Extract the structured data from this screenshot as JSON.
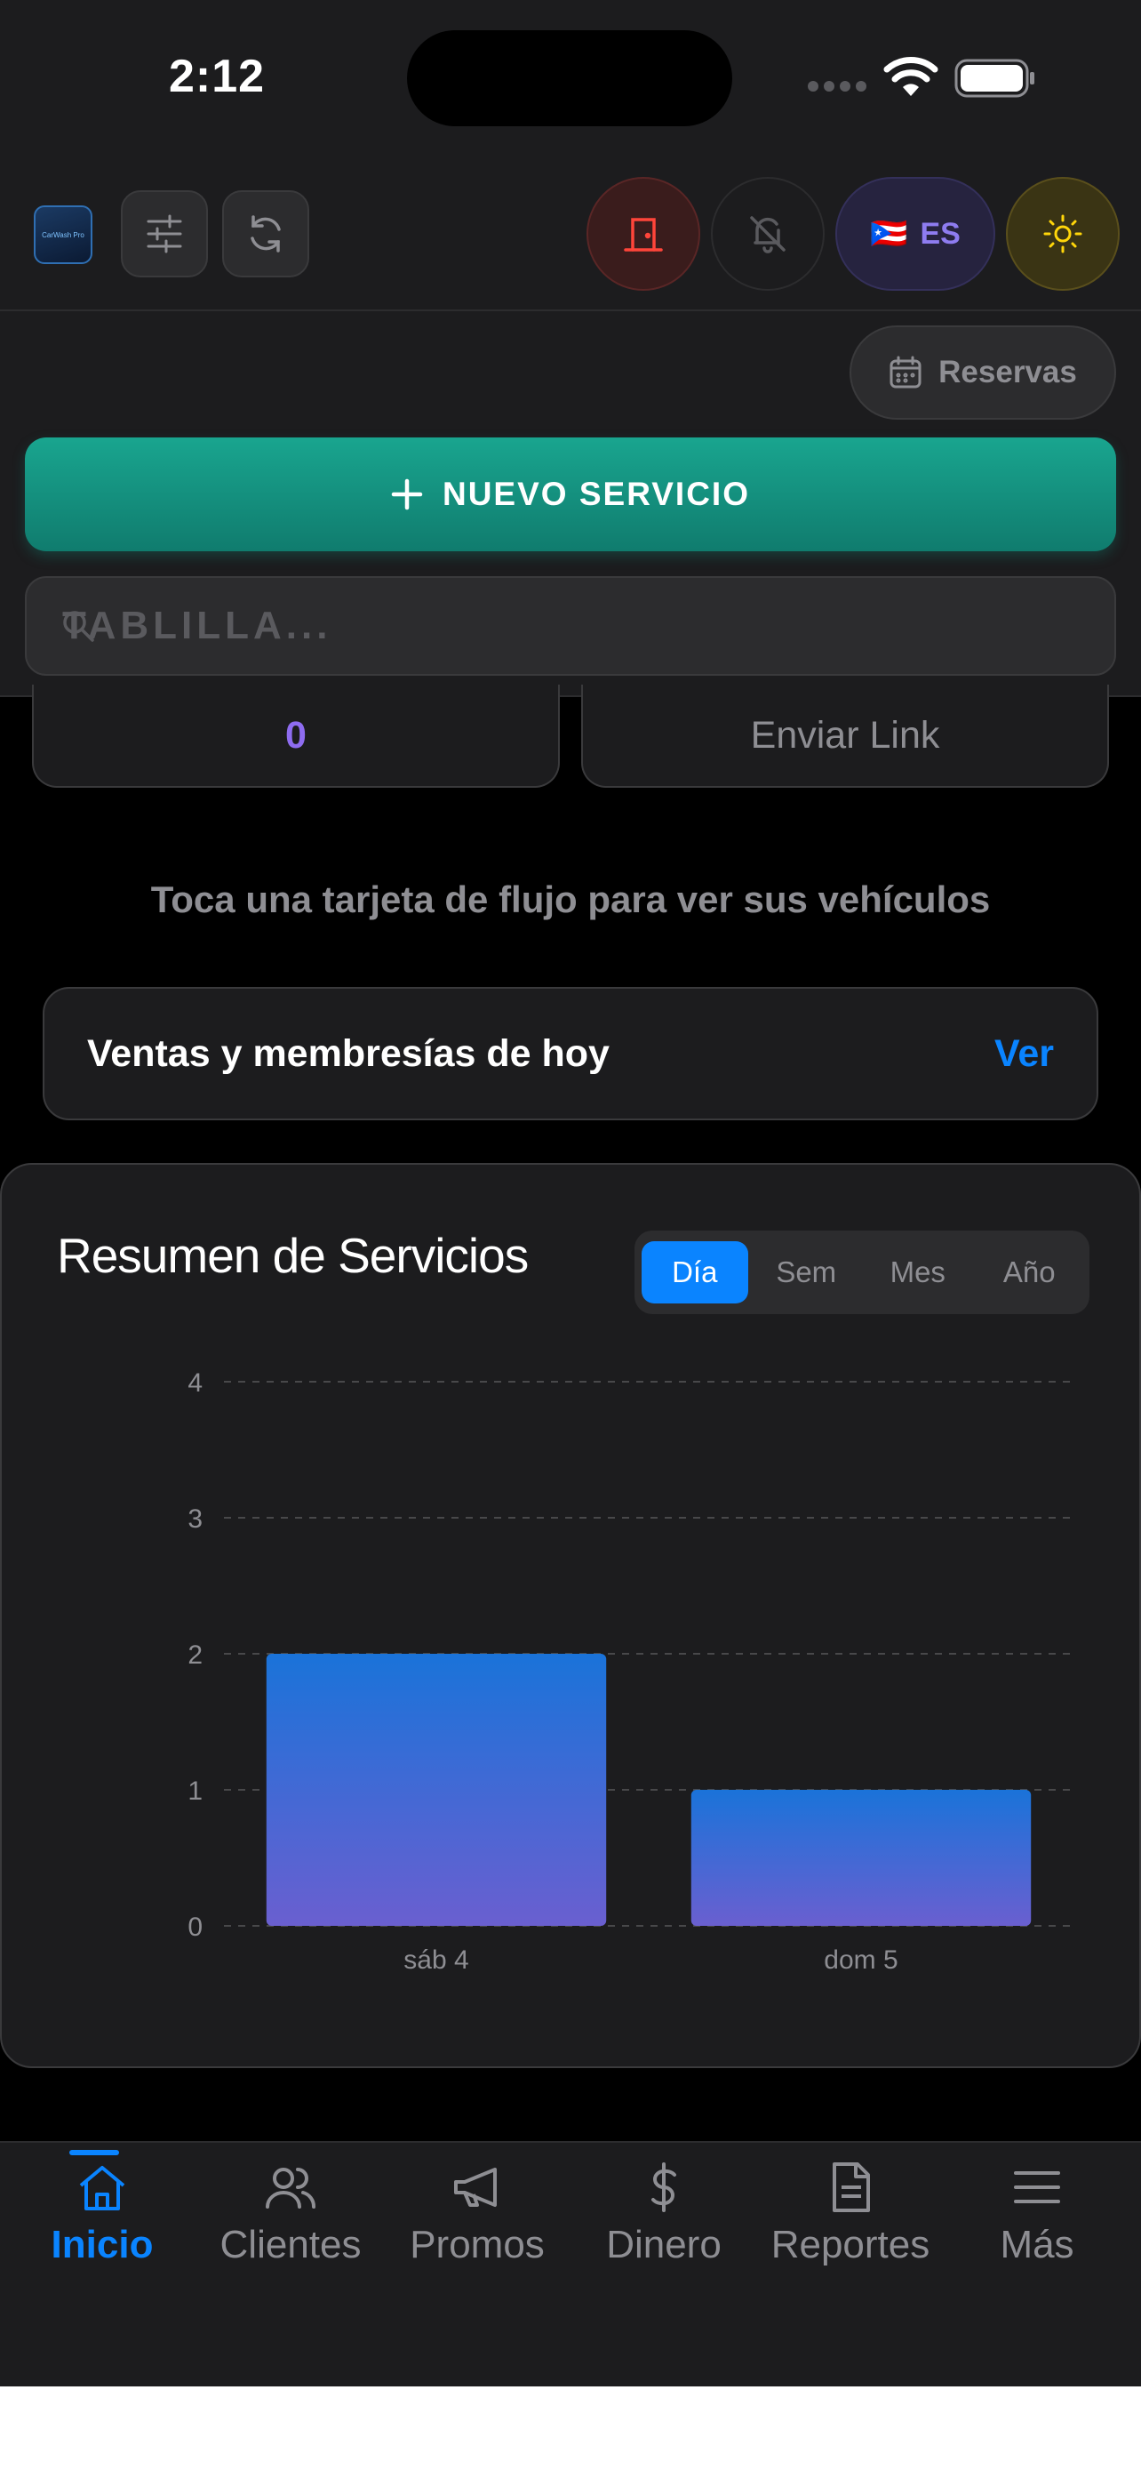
{
  "status_bar": {
    "time": "2:12"
  },
  "header": {
    "logo_text": "CarWash Pro",
    "lang_flag": "🇵🇷",
    "lang_label": "ES"
  },
  "toolbar": {
    "reservas_label": "Reservas",
    "nuevo_servicio_label": "NUEVO SERVICIO",
    "search_placeholder": "TABLILLA..."
  },
  "flow_cards": [
    {
      "value": "0"
    },
    {
      "value": "Enviar Link"
    }
  ],
  "hint": "Toca una tarjeta de flujo para ver sus vehículos",
  "ventas": {
    "title": "Ventas y membresías de hoy",
    "action": "Ver"
  },
  "resumen": {
    "title": "Resumen de Servicios",
    "segments": [
      "Día",
      "Sem",
      "Mes",
      "Año"
    ],
    "active_segment": "Día"
  },
  "chart_data": {
    "type": "bar",
    "categories": [
      "sáb 4",
      "dom 5"
    ],
    "values": [
      2,
      1
    ],
    "ylim": [
      0,
      4
    ],
    "yticks": [
      "0",
      "1",
      "2",
      "3",
      "4"
    ],
    "grid": true,
    "colors": {
      "bar_top": "#1a73d9",
      "bar_bottom": "#6a5fd0"
    }
  },
  "tabbar": {
    "items": [
      {
        "label": "Inicio",
        "icon": "home-icon"
      },
      {
        "label": "Clientes",
        "icon": "users-icon"
      },
      {
        "label": "Promos",
        "icon": "megaphone-icon"
      },
      {
        "label": "Dinero",
        "icon": "dollar-icon"
      },
      {
        "label": "Reportes",
        "icon": "document-icon"
      },
      {
        "label": "Más",
        "icon": "menu-icon"
      }
    ],
    "active": "Inicio"
  },
  "colors": {
    "accent": "#0a84ff",
    "purple": "#8e6cf0",
    "teal": "#19a58f",
    "danger": "#ff453a",
    "sun": "#ffd60a"
  }
}
